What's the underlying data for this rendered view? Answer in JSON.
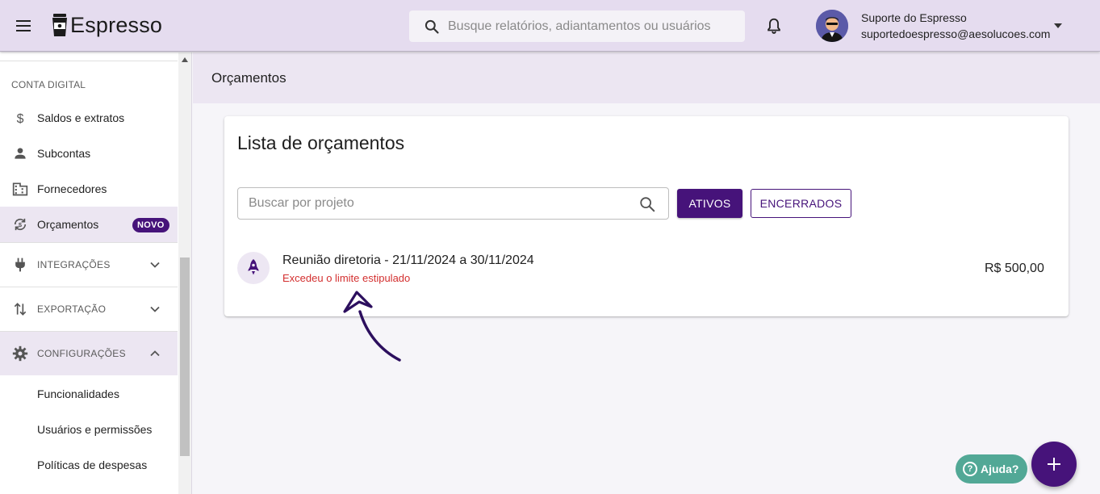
{
  "app": {
    "name": "Espresso"
  },
  "header": {
    "search_placeholder": "Busque relatórios, adiantamentos ou usuários",
    "user_name": "Suporte do Espresso",
    "user_email": "suportedoespresso@aesolucoes.com"
  },
  "sidebar": {
    "section_label": "CONTA DIGITAL",
    "items": [
      {
        "label": "Saldos e extratos",
        "icon": "dollar-icon"
      },
      {
        "label": "Subcontas",
        "icon": "person-icon"
      },
      {
        "label": "Fornecedores",
        "icon": "building-icon"
      },
      {
        "label": "Orçamentos",
        "icon": "budget-sync-icon",
        "badge": "NOVO"
      }
    ],
    "groups": [
      {
        "label": "INTEGRAÇÕES",
        "icon": "plug-icon",
        "expanded": false
      },
      {
        "label": "EXPORTAÇÃO",
        "icon": "sort-arrows-icon",
        "expanded": false
      },
      {
        "label": "CONFIGURAÇÕES",
        "icon": "gear-icon",
        "expanded": true
      }
    ],
    "config_items": [
      "Funcionalidades",
      "Usuários e permissões",
      "Políticas de despesas"
    ]
  },
  "main": {
    "page_title": "Orçamentos",
    "card_title": "Lista de orçamentos",
    "search_placeholder": "Buscar por projeto",
    "filters": {
      "active": "ATIVOS",
      "closed": "ENCERRADOS"
    },
    "rows": [
      {
        "title": "Reunião diretoria - 21/11/2024 a 30/11/2024",
        "status": "Excedeu o limite estipulado",
        "amount": "R$ 500,00",
        "icon": "rocket-icon"
      }
    ]
  },
  "floating": {
    "help_label": "Ajuda?",
    "help_glyph": "?"
  },
  "colors": {
    "primary": "#46137a",
    "topbar": "#e5dcef",
    "error": "#d32f2f",
    "help": "#52a896"
  }
}
